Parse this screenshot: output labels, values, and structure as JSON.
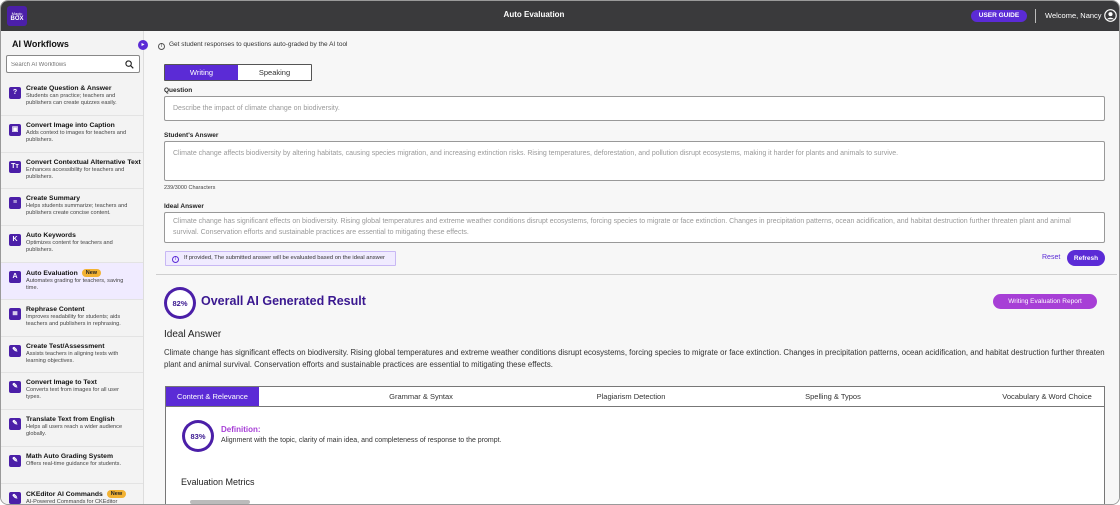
{
  "topbar": {
    "logo_line1": "Magic",
    "logo_line2": "BOX",
    "title": "Auto Evaluation",
    "user_guide": "USER GUIDE",
    "welcome": "Welcome, Nancy",
    "user_icon": "user-circle-icon"
  },
  "sidebar": {
    "title": "AI Workflows",
    "collapse_icon": "arrow-right-icon",
    "search_placeholder": "Search AI Workflows",
    "items": [
      {
        "icon": "question-icon",
        "glyph": "?",
        "title": "Create Question & Answer",
        "desc": "Students can practice; teachers and publishers can create quizzes easily."
      },
      {
        "icon": "image-caption-icon",
        "glyph": "▣",
        "title": "Convert Image into Caption",
        "desc": "Adds context to images for teachers and publishers."
      },
      {
        "icon": "alt-text-icon",
        "glyph": "Tт",
        "title": "Convert Contextual Alternative Text",
        "desc": "Enhances accessibility for teachers and publishers."
      },
      {
        "icon": "summary-icon",
        "glyph": "≡",
        "title": "Create Summary",
        "desc": "Helps students summarize; teachers and publishers create concise content."
      },
      {
        "icon": "keyword-icon",
        "glyph": "K",
        "title": "Auto Keywords",
        "desc": "Optimizes content for teachers and publishers."
      },
      {
        "icon": "auto-evaluation-icon",
        "glyph": "A",
        "title": "Auto Evaluation",
        "badge": "New",
        "desc": "Automates grading for teachers, saving time."
      },
      {
        "icon": "rephrase-icon",
        "glyph": "≣",
        "title": "Rephrase Content",
        "desc": "Improves readability for students; aids teachers and publishers in rephrasing."
      },
      {
        "icon": "test-icon",
        "glyph": "✎",
        "title": "Create Test/Assessment",
        "desc": "Assists teachers in aligning tests with learning objectives."
      },
      {
        "icon": "image-text-icon",
        "glyph": "✎",
        "title": "Convert Image to Text",
        "desc": "Converts text from images for all user types."
      },
      {
        "icon": "translate-icon",
        "glyph": "✎",
        "title": "Translate Text from English",
        "desc": "Helps all users reach a wider audience globally."
      },
      {
        "icon": "math-grading-icon",
        "glyph": "✎",
        "title": "Math Auto Grading System",
        "desc": "Offers real-time guidance for students."
      },
      {
        "icon": "ckeditor-icon",
        "glyph": "✎",
        "title": "CKEditor AI Commands",
        "badge": "New",
        "desc": "AI-Powered Commands for CKEditor"
      }
    ]
  },
  "main": {
    "info": "Get student responses to questions auto-graded by the AI tool",
    "tabs": [
      {
        "label": "Writing",
        "active": true
      },
      {
        "label": "Speaking",
        "active": false
      }
    ],
    "question_label": "Question",
    "question_placeholder": "Describe the impact of climate change on biodiversity.",
    "answer_label": "Student's Answer",
    "answer_placeholder": "Climate change affects biodiversity by altering habitats, causing species migration, and increasing extinction risks. Rising temperatures, deforestation, and pollution disrupt ecosystems, making it harder for plants and animals to survive.",
    "char_count": "239/3000 Characters",
    "ideal_label": "Ideal Answer",
    "ideal_placeholder": "Climate change has significant effects on biodiversity. Rising global temperatures and extreme weather conditions disrupt ecosystems, forcing species to migrate or face extinction. Changes in precipitation patterns, ocean acidification, and habitat destruction further threaten plant and animal survival. Conservation efforts and sustainable practices are essential to mitigating these effects.",
    "hint": "If provided, The submitted answer will be evaluated based on the ideal answer",
    "reset": "Reset",
    "refresh": "Refresh"
  },
  "result": {
    "score": "82%",
    "title": "Overall AI Generated Result",
    "report_button": "Writing Evaluation Report",
    "ideal_title": "Ideal Answer",
    "ideal_text": "Climate change has significant effects on biodiversity. Rising global temperatures and extreme weather conditions disrupt ecosystems, forcing species to migrate or face extinction. Changes in precipitation patterns, ocean acidification, and habitat destruction further threaten plant and animal survival. Conservation efforts and sustainable practices are essential to mitigating these effects.",
    "tabs": [
      "Content & Relevance",
      "Grammar & Syntax",
      "Plagiarism Detection",
      "Spelling & Typos",
      "Vocabulary & Word Choice"
    ],
    "active_tab": 0,
    "criterion_score": "83%",
    "definition_title": "Definition:",
    "definition_text": "Alignment with the topic, clarity of main idea, and completeness of response to the prompt.",
    "metrics_title": "Evaluation Metrics"
  },
  "colors": {
    "accent": "#5b2bd6",
    "accent_dark": "#4b1fa8",
    "report": "#a73fd6",
    "topbar": "#3a3a3c",
    "badge": "#f2b233"
  }
}
